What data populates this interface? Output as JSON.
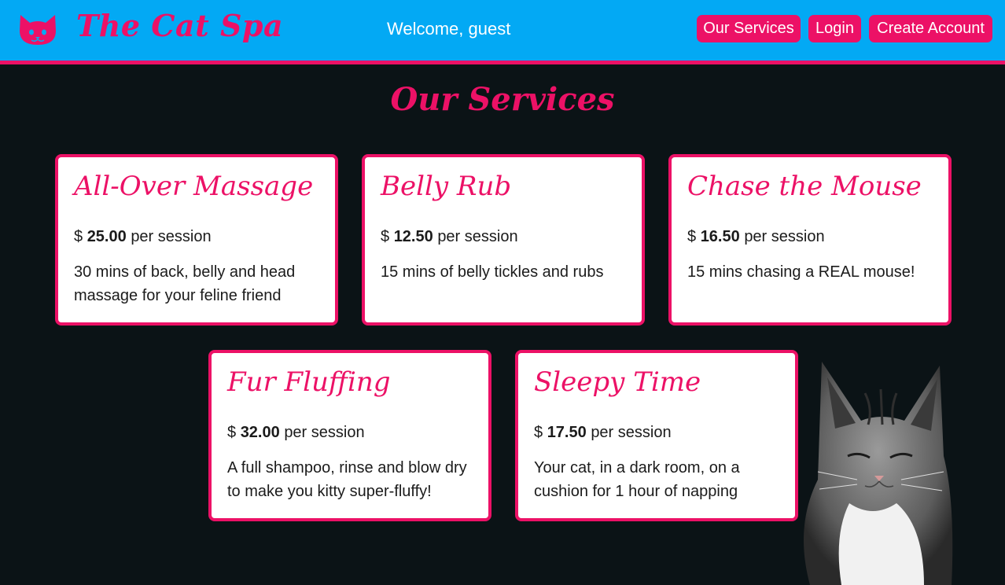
{
  "header": {
    "brand": "The Cat Spa",
    "welcome": "Welcome, guest",
    "nav": {
      "services_label": "Our Services",
      "login_label": "Login",
      "create_label": "Create Account"
    },
    "logo_icon": "cat-face-icon"
  },
  "main": {
    "title": "Our Services",
    "currency_symbol": "$",
    "per_session_label": "per session",
    "services": [
      {
        "name": "All-Over Massage",
        "price": "25.00",
        "description": "30 mins of back, belly and head massage for your feline friend"
      },
      {
        "name": "Belly Rub",
        "price": "12.50",
        "description": "15 mins of belly tickles and rubs"
      },
      {
        "name": "Chase the Mouse",
        "price": "16.50",
        "description": "15 mins chasing a REAL mouse!"
      },
      {
        "name": "Fur Fluffing",
        "price": "32.00",
        "description": "A full shampoo, rinse and blow dry to make you kitty super-fluffy!"
      },
      {
        "name": "Sleepy Time",
        "price": "17.50",
        "description": "Your cat, in a dark room, on a cushion for 1 hour of napping"
      }
    ]
  },
  "colors": {
    "header_bg": "#03a9f4",
    "accent": "#ec1166",
    "page_bg": "#0b1316",
    "card_bg": "#ffffff"
  }
}
